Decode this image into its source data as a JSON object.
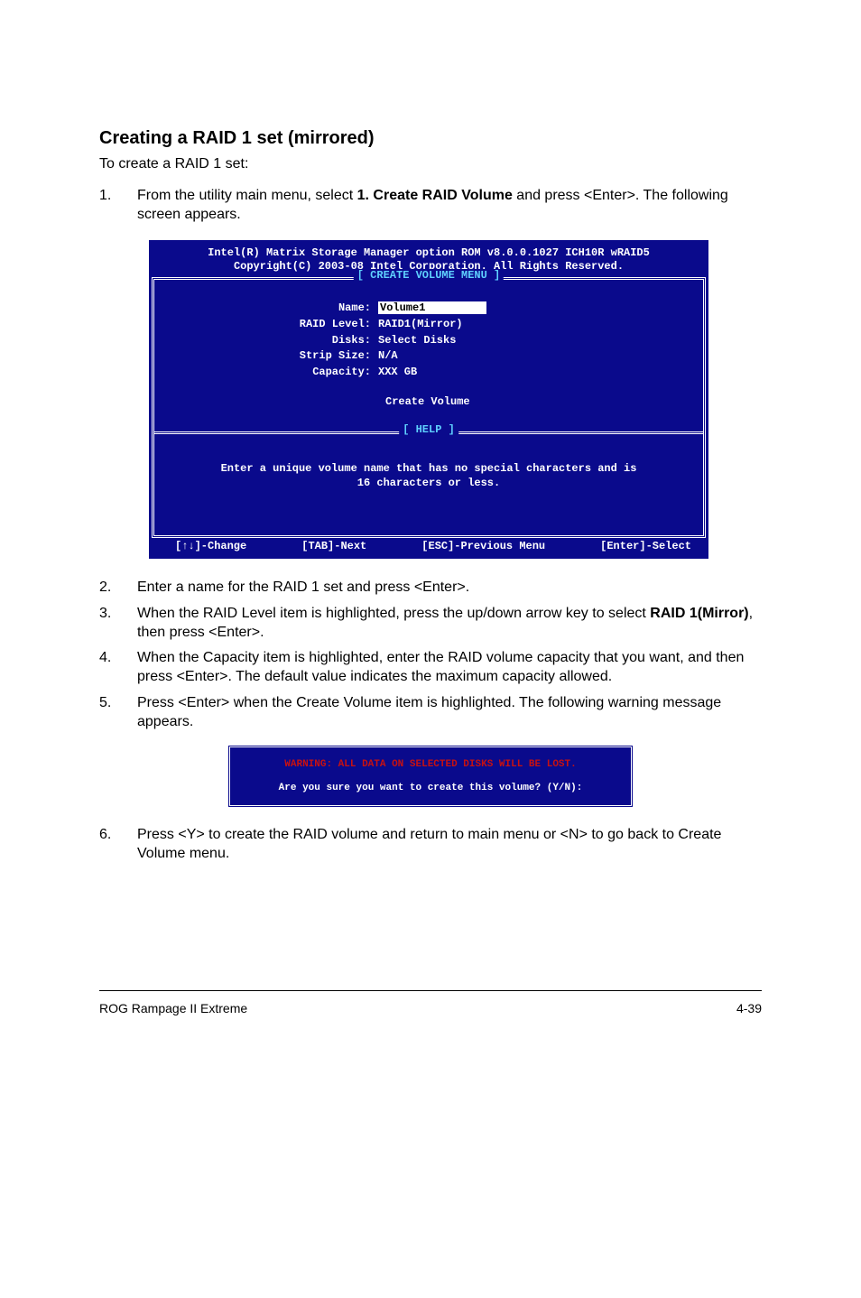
{
  "heading": "Creating a RAID 1 set (mirrored)",
  "intro": "To create a RAID 1 set:",
  "step1_prefix": "From the utility main menu, select ",
  "step1_bold": "1. Create RAID Volume",
  "step1_suffix": " and press <Enter>. The following screen appears.",
  "screenshot": {
    "title1": "Intel(R) Matrix Storage Manager option ROM v8.0.0.1027 ICH10R wRAID5",
    "title2": "Copyright(C) 2003-08 Intel Corporation. All Rights Reserved.",
    "panel1_title": "[ CREATE VOLUME MENU ]",
    "fields": {
      "name_label": "Name:",
      "name_value": "Volume1",
      "raid_label": "RAID Level:",
      "raid_value": "RAID1(Mirror)",
      "disks_label": "Disks:",
      "disks_value": "Select Disks",
      "strip_label": "Strip Size:",
      "strip_value": "N/A",
      "cap_label": "Capacity:",
      "cap_value": "XXX   GB"
    },
    "create_action": "Create Volume",
    "panel2_title": "[ HELP ]",
    "help_line1": "Enter a unique volume name that has no special characters and is",
    "help_line2": "16 characters or less.",
    "footer": {
      "change": "[↑↓]-Change",
      "next": "[TAB]-Next",
      "prev": "[ESC]-Previous Menu",
      "select": "[Enter]-Select"
    }
  },
  "step2": "Enter a name for the RAID 1 set and press <Enter>.",
  "step3_prefix": "When the RAID Level item is highlighted, press the up/down arrow key to select ",
  "step3_bold": "RAID 1(Mirror)",
  "step3_suffix": ", then press <Enter>.",
  "step4": "When the Capacity item is highlighted, enter the RAID volume capacity that you want, and then press <Enter>. The default value indicates the maximum capacity allowed.",
  "step5": "Press <Enter> when the Create Volume item is highlighted. The following warning message appears.",
  "dialog": {
    "warning": "WARNING: ALL DATA ON SELECTED DISKS WILL BE LOST.",
    "prompt": "Are you sure you want to create this volume? (Y/N):"
  },
  "step6": "Press <Y> to create the RAID volume and return to main menu or <N> to go back to Create Volume menu.",
  "footer_left": "ROG Rampage II Extreme",
  "footer_right": "4-39"
}
